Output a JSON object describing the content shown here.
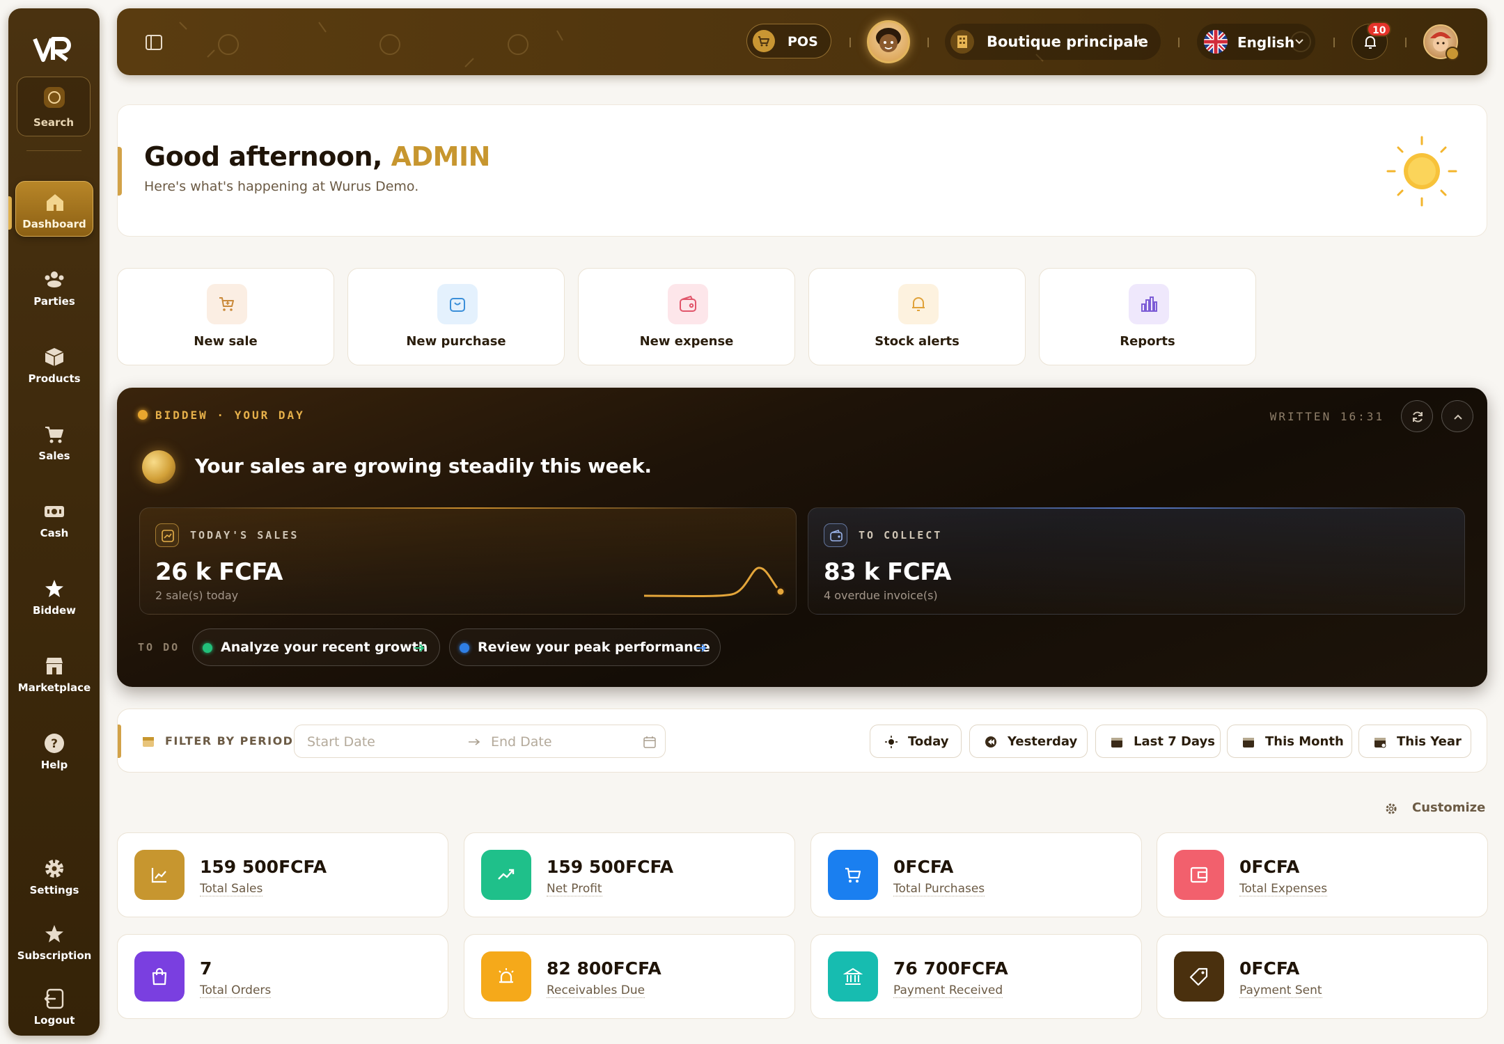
{
  "sidebar": {
    "search_label": "Search",
    "items": [
      {
        "label": "Dashboard",
        "icon": "home-icon"
      },
      {
        "label": "Parties",
        "icon": "users-icon"
      },
      {
        "label": "Products",
        "icon": "box-icon"
      },
      {
        "label": "Sales",
        "icon": "cart-icon"
      },
      {
        "label": "Cash",
        "icon": "cash-icon"
      },
      {
        "label": "Biddew",
        "icon": "star-icon"
      },
      {
        "label": "Marketplace",
        "icon": "store-icon"
      },
      {
        "label": "Help",
        "icon": "help-icon"
      },
      {
        "label": "Settings",
        "icon": "gear-icon"
      },
      {
        "label": "Subscription",
        "icon": "badge-star-icon"
      },
      {
        "label": "Logout",
        "icon": "logout-icon"
      }
    ]
  },
  "header": {
    "pos_label": "POS",
    "shop_label": "Boutique principale",
    "language_label": "English",
    "notifications_count": "10"
  },
  "greeting": {
    "prefix": "Good afternoon, ",
    "name": "ADMIN",
    "subtitle": "Here's what's happening at Wurus Demo."
  },
  "quick_actions": [
    {
      "label": "New sale",
      "icon": "cart-plus-icon",
      "bg": "#fbeee3",
      "color": "#c9893a"
    },
    {
      "label": "New purchase",
      "icon": "bag-icon",
      "bg": "#e4f1fd",
      "color": "#3b8fd9"
    },
    {
      "label": "New expense",
      "icon": "wallet-icon",
      "bg": "#fde6ea",
      "color": "#e1566b"
    },
    {
      "label": "Stock alerts",
      "icon": "bell-icon",
      "bg": "#fdf2df",
      "color": "#e0a23a"
    },
    {
      "label": "Reports",
      "icon": "chart-icon",
      "bg": "#efe8fc",
      "color": "#7c5cd6"
    }
  ],
  "biddew": {
    "tag": "BIDDEW · YOUR DAY",
    "written": "WRITTEN 16:31",
    "message": "Your sales are growing steadily this week.",
    "cards": [
      {
        "label": "TODAY'S SALES",
        "value": "26 k FCFA",
        "sub": "2 sale(s) today"
      },
      {
        "label": "TO COLLECT",
        "value": "83 k FCFA",
        "sub": "4 overdue invoice(s)"
      }
    ],
    "todo_label": "TO DO",
    "todos": [
      {
        "label": "Analyze your recent growth",
        "dot": "#22c07a"
      },
      {
        "label": "Review your peak performance",
        "dot": "#2f7fe6"
      }
    ]
  },
  "filter": {
    "label": "FILTER BY PERIOD",
    "start_placeholder": "Start Date",
    "end_placeholder": "End Date",
    "periods": [
      "Today",
      "Yesterday",
      "Last 7 Days",
      "This Month",
      "This Year"
    ]
  },
  "customize_label": "Customize",
  "stats": [
    {
      "value": "159 500FCFA",
      "label": "Total Sales",
      "color": "#c7962f",
      "icon": "chart-line-icon"
    },
    {
      "value": "159 500FCFA",
      "label": "Net Profit",
      "color": "#1fc08a",
      "icon": "trend-up-icon"
    },
    {
      "value": "0FCFA",
      "label": "Total Purchases",
      "color": "#1a7ff0",
      "icon": "cart-icon"
    },
    {
      "value": "0FCFA",
      "label": "Total Expenses",
      "color": "#f2606d",
      "icon": "wallet-icon"
    },
    {
      "value": "7",
      "label": "Total Orders",
      "color": "#7a3fe0",
      "icon": "shopping-bag-icon"
    },
    {
      "value": "82 800FCFA",
      "label": "Receivables Due",
      "color": "#f5a91a",
      "icon": "alarm-icon"
    },
    {
      "value": "76 700FCFA",
      "label": "Payment Received",
      "color": "#17bcb0",
      "icon": "bank-icon"
    },
    {
      "value": "0FCFA",
      "label": "Payment Sent",
      "color": "#4a300e",
      "icon": "tag-icon"
    }
  ]
}
